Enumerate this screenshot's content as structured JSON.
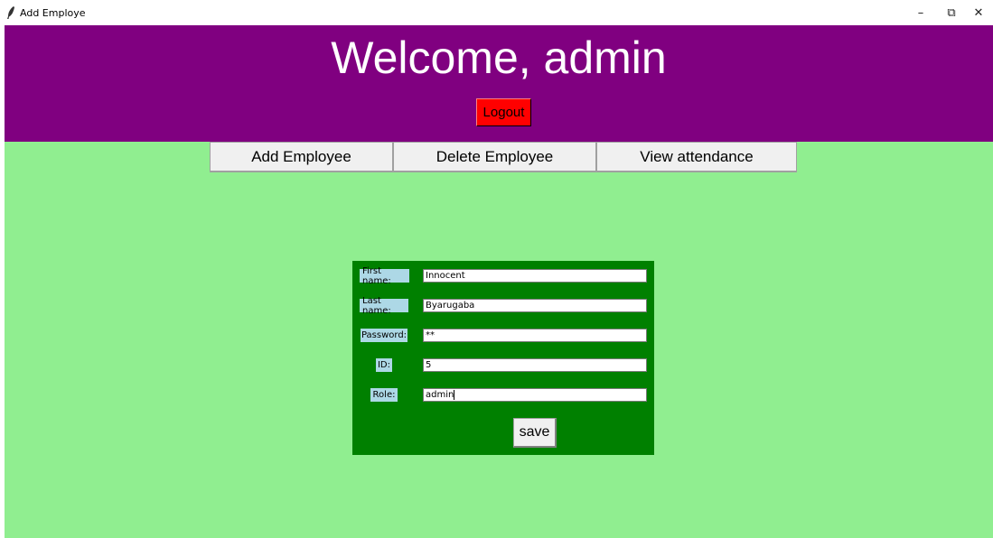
{
  "window": {
    "title": "Add Employe",
    "minimize_glyph": "–",
    "maximize_glyph": "⧉",
    "close_glyph": "✕"
  },
  "header": {
    "welcome_text": "Welcome, admin",
    "logout_label": "Logout"
  },
  "nav": {
    "items": [
      {
        "label": "Add Employee"
      },
      {
        "label": "Delete Employee"
      },
      {
        "label": "View attendance"
      }
    ]
  },
  "form": {
    "fields": [
      {
        "label": "First name:",
        "value": "Innocent"
      },
      {
        "label": "Last name:",
        "value": "Byarugaba"
      },
      {
        "label": "Password:",
        "value": "**"
      },
      {
        "label": "ID:",
        "value": "5"
      },
      {
        "label": "Role:",
        "value": "admin"
      }
    ],
    "save_label": "save"
  },
  "colors": {
    "header_bg": "#800080",
    "body_bg": "#90ee90",
    "form_bg": "#008000",
    "label_bg": "#add8e6",
    "logout_bg": "#ff0000"
  }
}
